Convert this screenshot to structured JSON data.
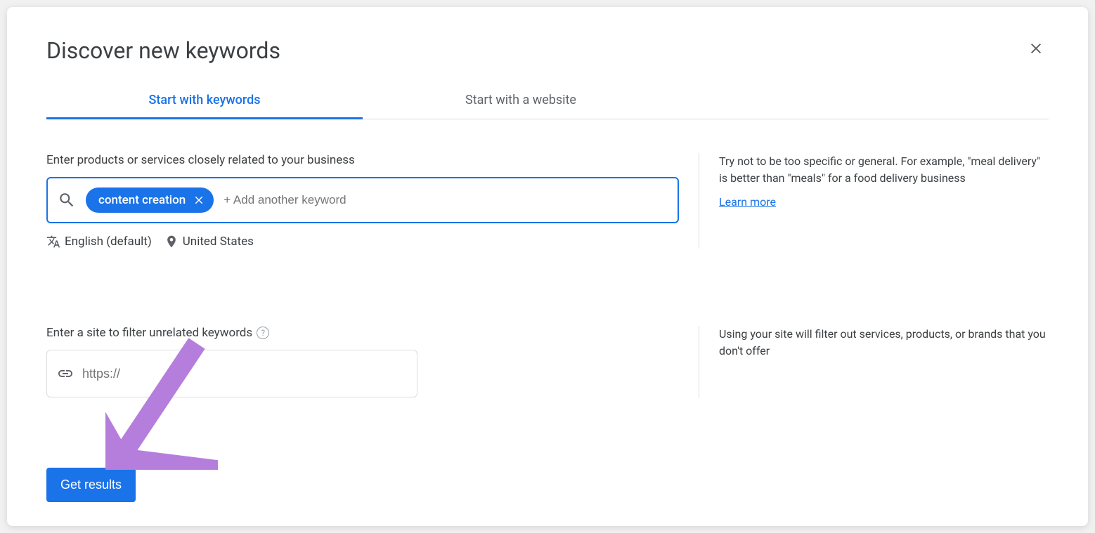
{
  "title": "Discover new keywords",
  "tabs": {
    "keywords": "Start with keywords",
    "website": "Start with a website"
  },
  "keywords_section": {
    "label": "Enter products or services closely related to your business",
    "chip": "content creation",
    "add_placeholder": "+ Add another keyword",
    "language": "English (default)",
    "location": "United States",
    "hint": "Try not to be too specific or general. For example, \"meal delivery\" is better than \"meals\" for a food delivery business",
    "learn_more": "Learn more"
  },
  "site_section": {
    "label": "Enter a site to filter unrelated keywords",
    "placeholder": "https://",
    "hint": "Using your site will filter out services, products, or brands that you don't offer"
  },
  "get_results": "Get results"
}
